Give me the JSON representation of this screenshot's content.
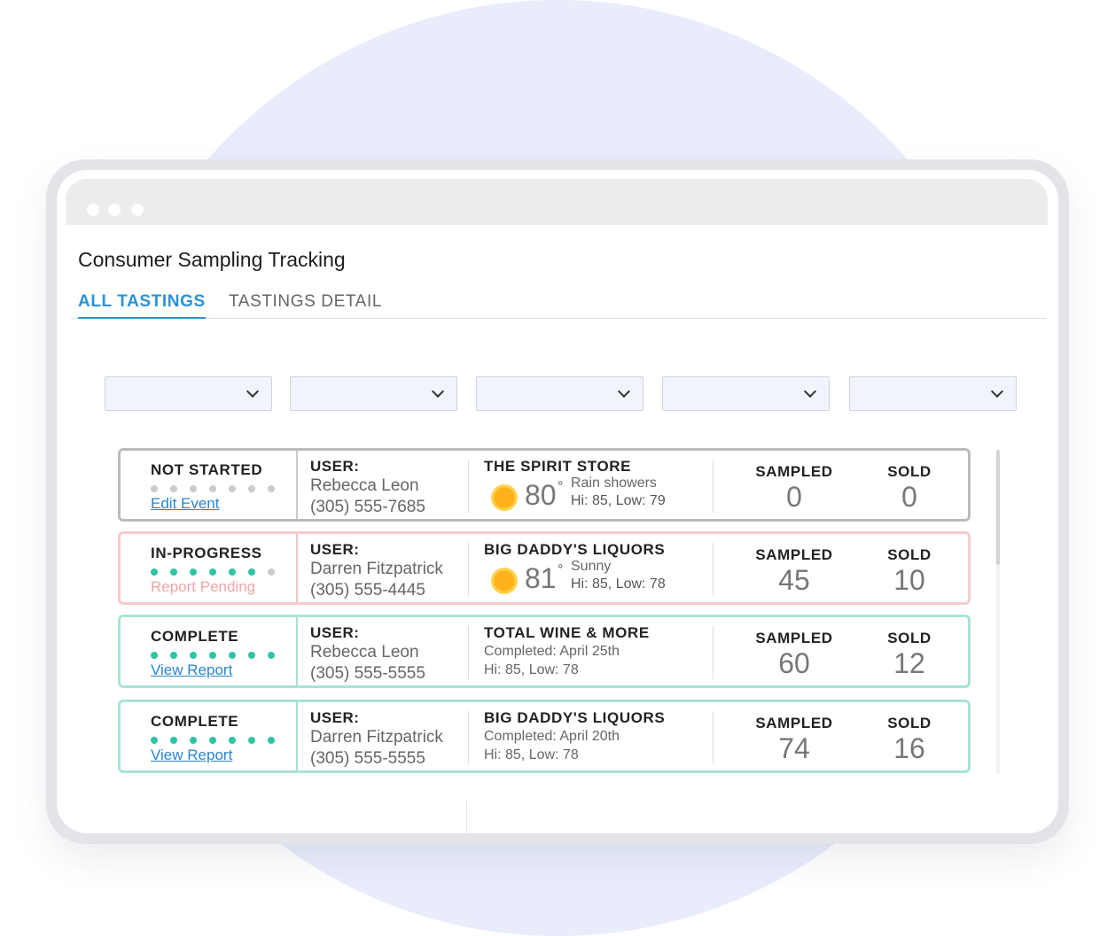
{
  "app": {
    "title": "Consumer Sampling Tracking"
  },
  "tabs": [
    {
      "label": "ALL TASTINGS",
      "active": true
    },
    {
      "label": "TASTINGS DETAIL",
      "active": false
    }
  ],
  "filters": [
    {
      "value": ""
    },
    {
      "value": ""
    },
    {
      "value": ""
    },
    {
      "value": ""
    },
    {
      "value": ""
    }
  ],
  "colors": {
    "accent": "#2a93d5",
    "progress_dot": "#2fc4a4",
    "not_started_border": "#b9bbbf",
    "in_progress_border": "#f6cccc",
    "complete_border": "#a8e3d6"
  },
  "events": [
    {
      "status": "NOT STARTED",
      "progress": {
        "done": 0,
        "total": 7
      },
      "link": "Edit Event",
      "user_label": "USER:",
      "user_name": "Rebecca Leon",
      "user_phone": "(305) 555-7685",
      "store": "THE SPIRIT STORE",
      "weather": {
        "icon": "sun-icon",
        "temp": "80",
        "condition": "Rain showers",
        "hilo": "Hi: 85, Low: 79"
      },
      "sampled_label": "SAMPLED",
      "sampled": "0",
      "sold_label": "SOLD",
      "sold": "0"
    },
    {
      "status": "IN-PROGRESS",
      "progress": {
        "done": 6,
        "total": 7
      },
      "link": "Report Pending",
      "user_label": "USER:",
      "user_name": "Darren Fitzpatrick",
      "user_phone": "(305) 555-4445",
      "store": "BIG DADDY'S LIQUORS",
      "weather": {
        "icon": "sun-icon",
        "temp": "81",
        "condition": "Sunny",
        "hilo": "Hi: 85, Low: 78"
      },
      "sampled_label": "SAMPLED",
      "sampled": "45",
      "sold_label": "SOLD",
      "sold": "10"
    },
    {
      "status": "COMPLETE",
      "progress": {
        "done": 7,
        "total": 7
      },
      "link": "View Report",
      "user_label": "USER:",
      "user_name": "Rebecca Leon",
      "user_phone": "(305) 555-5555",
      "store": "TOTAL WINE & MORE",
      "completed": "Completed: April 25th",
      "hilo": "Hi: 85, Low: 78",
      "sampled_label": "SAMPLED",
      "sampled": "60",
      "sold_label": "SOLD",
      "sold": "12"
    },
    {
      "status": "COMPLETE",
      "progress": {
        "done": 7,
        "total": 7
      },
      "link": "View Report",
      "user_label": "USER:",
      "user_name": "Darren Fitzpatrick",
      "user_phone": "(305) 555-5555",
      "store": "BIG DADDY'S LIQUORS",
      "completed": "Completed: April 20th",
      "hilo": "Hi: 85, Low: 78",
      "sampled_label": "SAMPLED",
      "sampled": "74",
      "sold_label": "SOLD",
      "sold": "16"
    }
  ]
}
